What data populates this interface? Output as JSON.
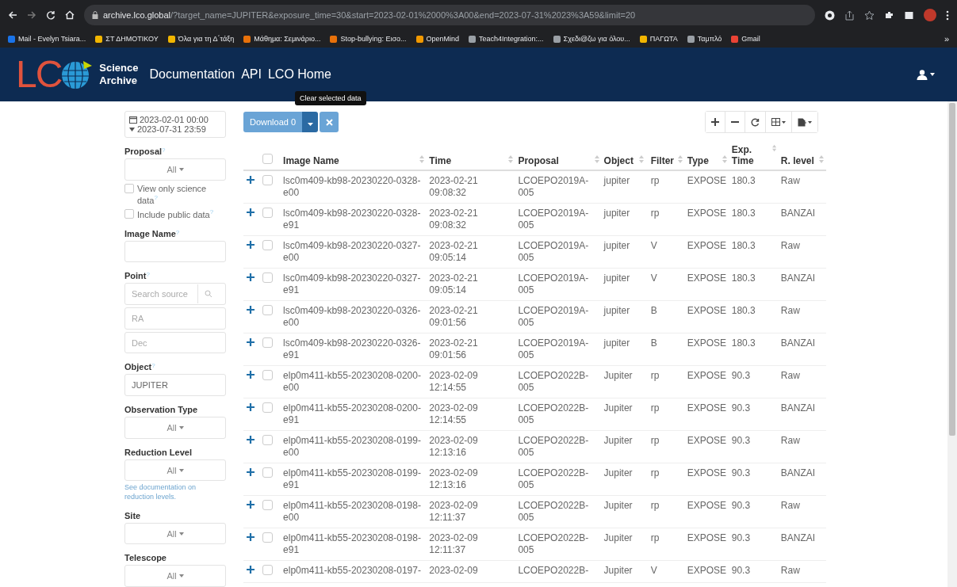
{
  "browser": {
    "url_host": "archive.lco.global",
    "url_rest": "/?target_name=JUPITER&exposure_time=30&start=2023-02-01%2000%3A00&end=2023-07-31%2023%3A59&limit=20",
    "bookmarks": [
      {
        "label": "Mail - Evelyn Tsiara...",
        "color": "#1a73e8"
      },
      {
        "label": "ΣΤ ΔΗΜΟΤΙΚΟΥ",
        "color": "#f2b600"
      },
      {
        "label": "Όλα για τη Δ΄τάξη",
        "color": "#f2b600"
      },
      {
        "label": "Μάθημα: Σεμινάριο...",
        "color": "#e8710a"
      },
      {
        "label": "Stop-bullying: Εισο...",
        "color": "#e8710a"
      },
      {
        "label": "OpenMind",
        "color": "#f29900"
      },
      {
        "label": "Teach4Integration:...",
        "color": "#9aa0a6"
      },
      {
        "label": "Σχεδι@ζω για όλου...",
        "color": "#9aa0a6"
      },
      {
        "label": "ΠΑΓΩΤΑ",
        "color": "#f2b600"
      },
      {
        "label": "Ταμπλό",
        "color": "#9aa0a6"
      },
      {
        "label": "Gmail",
        "color": "#ea4335"
      }
    ],
    "more": "»"
  },
  "nav": {
    "logo": "LC",
    "brand_top": "Science",
    "brand_bottom": "Archive",
    "links": [
      "Documentation",
      "API",
      "LCO Home"
    ]
  },
  "sidebar": {
    "date_start": "2023-02-01 00:00",
    "date_end": "2023-07-31 23:59",
    "sections": [
      {
        "kind": "dropdown",
        "label": "Proposal",
        "help": "?",
        "value": "All"
      },
      {
        "kind": "checkbox",
        "label": "View only science data",
        "help": "?",
        "checked": false
      },
      {
        "kind": "checkbox",
        "label": "Include public data",
        "help": "?",
        "checked": false
      },
      {
        "kind": "text",
        "label": "Image Name",
        "help": "?"
      },
      {
        "kind": "point",
        "label": "Point",
        "help": "?",
        "placeholder": "Search source",
        "ra_placeholder": "RA",
        "dec_placeholder": "Dec"
      },
      {
        "kind": "text",
        "label": "Object",
        "help": "?",
        "value": "JUPITER"
      },
      {
        "kind": "dropdown",
        "label": "Observation Type",
        "value": "All"
      },
      {
        "kind": "dropdown",
        "label": "Reduction Level",
        "value": "All",
        "note": "See documentation on reduction levels."
      },
      {
        "kind": "dropdown",
        "label": "Site",
        "value": "All"
      },
      {
        "kind": "dropdown",
        "label": "Telescope",
        "value": "All"
      }
    ]
  },
  "toolbar": {
    "download": "Download 0",
    "tooltip": "Clear selected data"
  },
  "table": {
    "all_selected": false,
    "columns": [
      "Image Name",
      "Time",
      "Proposal",
      "Object",
      "Filter",
      "Type",
      "Exp. Time",
      "R. level"
    ],
    "rows": [
      {
        "selected": false,
        "cells": [
          "lsc0m409-kb98-20230220-0328-e00",
          "2023-02-21 09:08:32",
          "LCOEPO2019A-005",
          "jupiter",
          "rp",
          "EXPOSE",
          "180.3",
          "Raw"
        ]
      },
      {
        "selected": false,
        "cells": [
          "lsc0m409-kb98-20230220-0328-e91",
          "2023-02-21 09:08:32",
          "LCOEPO2019A-005",
          "jupiter",
          "rp",
          "EXPOSE",
          "180.3",
          "BANZAI"
        ]
      },
      {
        "selected": false,
        "cells": [
          "lsc0m409-kb98-20230220-0327-e00",
          "2023-02-21 09:05:14",
          "LCOEPO2019A-005",
          "jupiter",
          "V",
          "EXPOSE",
          "180.3",
          "Raw"
        ]
      },
      {
        "selected": false,
        "cells": [
          "lsc0m409-kb98-20230220-0327-e91",
          "2023-02-21 09:05:14",
          "LCOEPO2019A-005",
          "jupiter",
          "V",
          "EXPOSE",
          "180.3",
          "BANZAI"
        ]
      },
      {
        "selected": false,
        "cells": [
          "lsc0m409-kb98-20230220-0326-e00",
          "2023-02-21 09:01:56",
          "LCOEPO2019A-005",
          "jupiter",
          "B",
          "EXPOSE",
          "180.3",
          "Raw"
        ]
      },
      {
        "selected": false,
        "cells": [
          "lsc0m409-kb98-20230220-0326-e91",
          "2023-02-21 09:01:56",
          "LCOEPO2019A-005",
          "jupiter",
          "B",
          "EXPOSE",
          "180.3",
          "BANZAI"
        ]
      },
      {
        "selected": false,
        "cells": [
          "elp0m411-kb55-20230208-0200-e00",
          "2023-02-09 12:14:55",
          "LCOEPO2022B-005",
          "Jupiter",
          "rp",
          "EXPOSE",
          "90.3",
          "Raw"
        ]
      },
      {
        "selected": false,
        "cells": [
          "elp0m411-kb55-20230208-0200-e91",
          "2023-02-09 12:14:55",
          "LCOEPO2022B-005",
          "Jupiter",
          "rp",
          "EXPOSE",
          "90.3",
          "BANZAI"
        ]
      },
      {
        "selected": false,
        "cells": [
          "elp0m411-kb55-20230208-0199-e00",
          "2023-02-09 12:13:16",
          "LCOEPO2022B-005",
          "Jupiter",
          "rp",
          "EXPOSE",
          "90.3",
          "Raw"
        ]
      },
      {
        "selected": false,
        "cells": [
          "elp0m411-kb55-20230208-0199-e91",
          "2023-02-09 12:13:16",
          "LCOEPO2022B-005",
          "Jupiter",
          "rp",
          "EXPOSE",
          "90.3",
          "BANZAI"
        ]
      },
      {
        "selected": false,
        "cells": [
          "elp0m411-kb55-20230208-0198-e00",
          "2023-02-09 12:11:37",
          "LCOEPO2022B-005",
          "Jupiter",
          "rp",
          "EXPOSE",
          "90.3",
          "Raw"
        ]
      },
      {
        "selected": false,
        "cells": [
          "elp0m411-kb55-20230208-0198-e91",
          "2023-02-09 12:11:37",
          "LCOEPO2022B-005",
          "Jupiter",
          "rp",
          "EXPOSE",
          "90.3",
          "BANZAI"
        ]
      },
      {
        "selected": false,
        "cells": [
          "elp0m411-kb55-20230208-0197-",
          "2023-02-09",
          "LCOEPO2022B-",
          "Jupiter",
          "V",
          "EXPOSE",
          "90.3",
          "Raw"
        ]
      }
    ]
  }
}
